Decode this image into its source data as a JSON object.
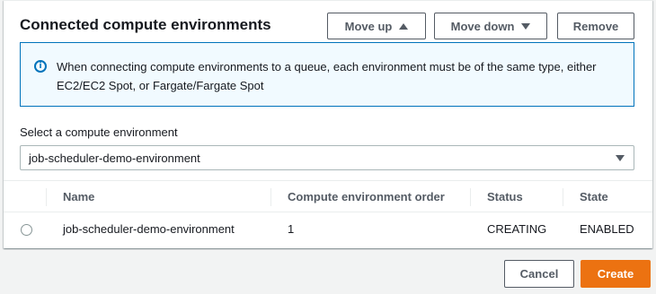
{
  "panel": {
    "title": "Connected compute environments",
    "buttons": {
      "move_up": "Move up",
      "move_down": "Move down",
      "remove": "Remove"
    },
    "info": {
      "icon": "info-icon",
      "text": "When connecting compute environments to a queue, each environment must be of the same type, either EC2/EC2 Spot, or Fargate/Fargate Spot"
    },
    "select": {
      "label": "Select a compute environment",
      "value": "job-scheduler-demo-environment"
    },
    "table": {
      "columns": [
        "Name",
        "Compute environment order",
        "Status",
        "State"
      ],
      "rows": [
        {
          "name": "job-scheduler-demo-environment",
          "order": "1",
          "status": "CREATING",
          "state": "ENABLED"
        }
      ]
    }
  },
  "footer": {
    "cancel": "Cancel",
    "create": "Create"
  },
  "colors": {
    "primary_button": "#ec7211",
    "info_border": "#0073bb",
    "info_bg": "#f1faff"
  }
}
